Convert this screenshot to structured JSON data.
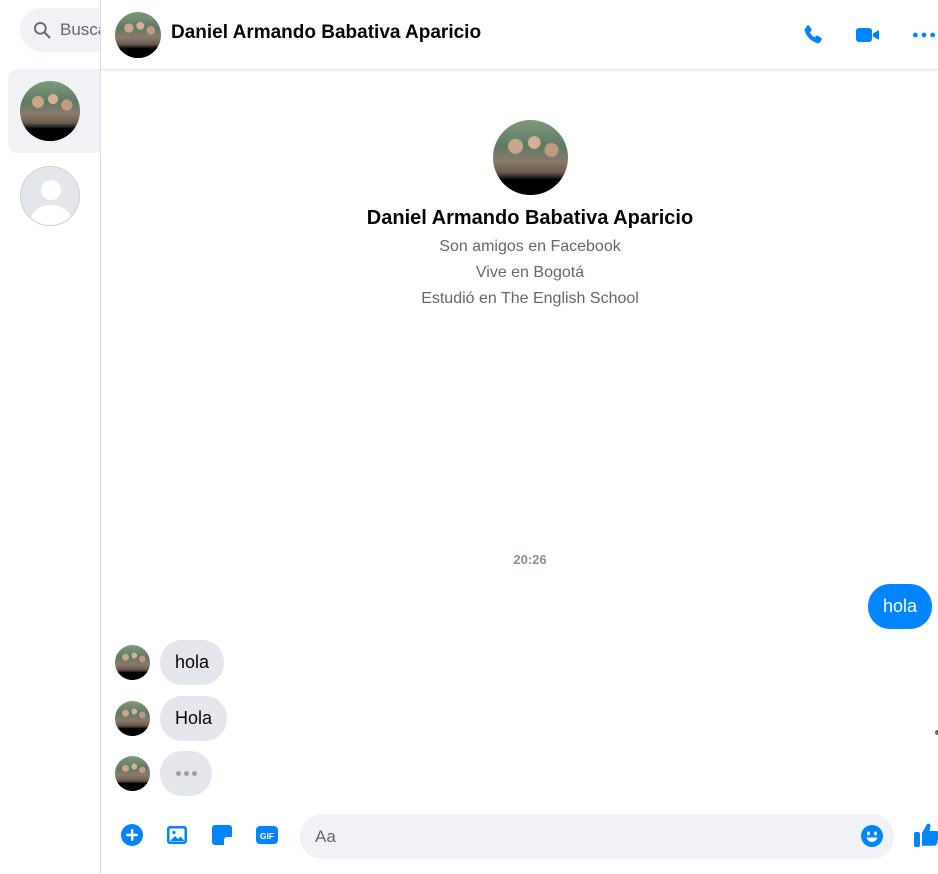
{
  "colors": {
    "accent": "#0084ff",
    "bubble_in": "#e4e6eb",
    "input_bg": "#f0f2f5",
    "muted_text": "#65676b"
  },
  "sidebar": {
    "search": {
      "placeholder": "Buscar",
      "visible_text": "Busca",
      "icon": "search-icon"
    },
    "conversations": [
      {
        "avatar": "photo",
        "active": true
      },
      {
        "avatar": "default-user",
        "active": false
      }
    ]
  },
  "header": {
    "name": "Daniel Armando Babativa Aparicio",
    "actions": [
      "phone-icon",
      "video-camera-icon",
      "more-options-icon"
    ]
  },
  "profile": {
    "name": "Daniel Armando Babativa Aparicio",
    "lines": [
      "Son amigos en Facebook",
      "Vive en Bogotá",
      "Estudió en The English School"
    ]
  },
  "thread": {
    "timestamp": "20:26",
    "messages": [
      {
        "direction": "outgoing",
        "text": "hola"
      },
      {
        "direction": "incoming",
        "text": "hola"
      },
      {
        "direction": "incoming",
        "text": "Hola"
      },
      {
        "direction": "incoming",
        "typing": true
      }
    ]
  },
  "composer": {
    "placeholder": "Aa",
    "buttons": [
      "plus-circle-icon",
      "image-icon",
      "sticker-icon",
      "gif-icon",
      "emoji-icon",
      "thumbs-up-icon"
    ]
  }
}
